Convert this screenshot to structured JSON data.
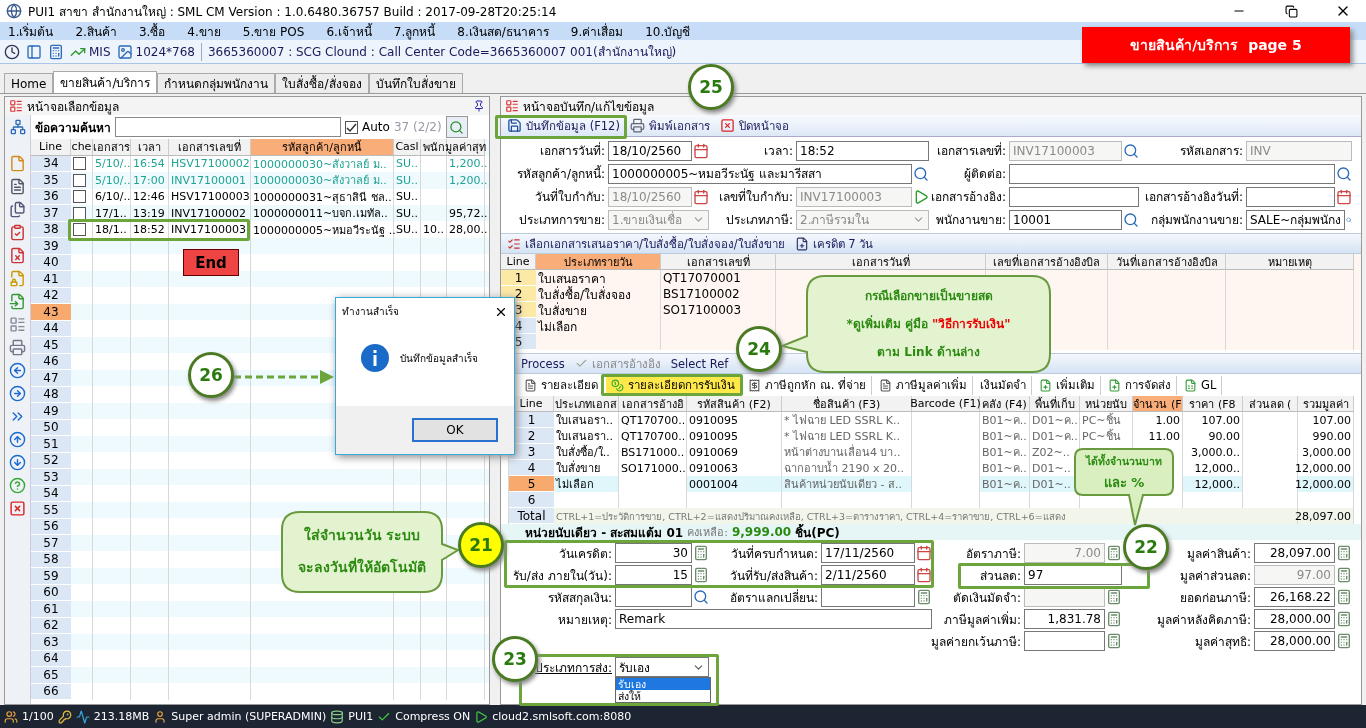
{
  "window": {
    "title": "PUI1 สาขา สำนักงานใหญ่ : SML CM Version : 1.0.6480.36757  Build : 2017-09-28T20:25:14"
  },
  "menu": [
    "1.เริ่มต้น",
    "2.สินค้า",
    "3.ซื้อ",
    "4.ขาย",
    "5.ขาย POS",
    "6.เจ้าหนี้",
    "7.ลูกหนี้",
    "8.เงินสด/ธนาคาร",
    "9.ค่าเสื่อม",
    "10.บัญชี"
  ],
  "toolbar": {
    "mis": "MIS",
    "resolution": "1024*768",
    "info": "3665360007 : SCG Clound : Call Center Code=3665360007 001(สำนักงานใหญ่)"
  },
  "banner": "ขายสินค้า/บริการ  page 5",
  "tabs": [
    {
      "label": "Home",
      "selected": false
    },
    {
      "label": "ขายสินค้า/บริการ",
      "selected": true
    },
    {
      "label": "กำหนดกลุ่มพนักงาน",
      "selected": false
    },
    {
      "label": "ใบสั่งซื้อ/สั่งจอง",
      "selected": false
    },
    {
      "label": "บันทึกใบสั่งขาย",
      "selected": false
    }
  ],
  "browser": {
    "title": "หน้าจอเลือกข้อมูล",
    "search_label": "ข้อความค้นหา",
    "auto": {
      "label": "Auto",
      "checked": true
    },
    "count": "37 (2/2)",
    "end_button": "End",
    "columns": [
      {
        "label": "Line",
        "sorted": false
      },
      {
        "label": "che",
        "sorted": false
      },
      {
        "label": "เอกสาร",
        "sorted": false
      },
      {
        "label": "เวลา",
        "sorted": false
      },
      {
        "label": "เอกสารเลขที่",
        "sorted": false
      },
      {
        "label": "รหัสลูกค้า/ลูกหนี้",
        "sorted": true
      },
      {
        "label": "Casl",
        "sorted": false
      },
      {
        "label": "พนัก",
        "sorted": false
      },
      {
        "label": "มูลค่าสุท",
        "sorted": false
      }
    ],
    "rows": [
      {
        "line": "34",
        "selected": false,
        "checked": false,
        "color": "#1fa393",
        "cells": [
          "5/10/..",
          "16:54",
          "HSV17100002",
          "1000000030~สังวาลย์ ม..",
          "SU..",
          null,
          "1,200.."
        ]
      },
      {
        "line": "35",
        "selected": false,
        "checked": false,
        "color": "#1fa393",
        "cells": [
          "5/10/..",
          "17:00",
          "INV17100001",
          "1000000030~สังวาลย์ ม..",
          "SU..",
          null,
          "1,200.."
        ]
      },
      {
        "line": "36",
        "selected": false,
        "checked": false,
        "color": "#000000",
        "cells": [
          "6/10/..",
          "12:46",
          "HSV17100003",
          "1000000031~สุธาสินี ชล..",
          "SU..",
          null,
          null
        ]
      },
      {
        "line": "37",
        "selected": false,
        "checked": false,
        "color": "#000000",
        "cells": [
          "17/1..",
          "13:19",
          "INV17100002",
          "1000000011~บจก.เมทัล..",
          "SU..",
          null,
          "95,72.."
        ]
      },
      {
        "line": "38",
        "selected": false,
        "checked": false,
        "color": "#000000",
        "cells": [
          "18/1..",
          "18:52",
          "INV17100003",
          "1000000005~หมอวีระนัฐ ..",
          "SU..",
          "10..",
          "28,00.."
        ]
      },
      {
        "line": "39",
        "selected": false
      },
      {
        "line": "40",
        "selected": false
      },
      {
        "line": "41",
        "selected": false
      },
      {
        "line": "42",
        "selected": false
      },
      {
        "line": "43",
        "selected": true
      },
      {
        "line": "44",
        "selected": false
      },
      {
        "line": "45",
        "selected": false
      },
      {
        "line": "46",
        "selected": false
      },
      {
        "line": "47",
        "selected": false
      },
      {
        "line": "48",
        "selected": false
      },
      {
        "line": "49",
        "selected": false
      },
      {
        "line": "50",
        "selected": false
      },
      {
        "line": "51",
        "selected": false
      },
      {
        "line": "52",
        "selected": false
      },
      {
        "line": "53",
        "selected": false
      },
      {
        "line": "54",
        "selected": false
      },
      {
        "line": "55",
        "selected": false
      },
      {
        "line": "56",
        "selected": false
      },
      {
        "line": "57",
        "selected": false
      },
      {
        "line": "58",
        "selected": false
      },
      {
        "line": "59",
        "selected": false
      },
      {
        "line": "60",
        "selected": false
      },
      {
        "line": "61",
        "selected": false
      },
      {
        "line": "62",
        "selected": false
      },
      {
        "line": "63",
        "selected": false
      },
      {
        "line": "64",
        "selected": false
      },
      {
        "line": "65",
        "selected": false
      },
      {
        "line": "66",
        "selected": false
      }
    ]
  },
  "dialog": {
    "title": "ทำงานสำเร็จ",
    "message": "บันทึกข้อมูลสำเร็จ",
    "ok": "OK"
  },
  "editor": {
    "title": "หน้าจอบันทึก/แก้ไขข้อมูล",
    "actions": [
      {
        "kind": "save",
        "label": "บันทึกข้อมูล (F12)"
      },
      {
        "kind": "print",
        "label": "พิมพ์เอกสาร"
      },
      {
        "kind": "close",
        "label": "ปิดหน้าจอ"
      }
    ],
    "header_rows": [
      [
        {
          "label": "เอกสารวันที่:",
          "value": "18/10/2560",
          "kind": "date",
          "disabled": false
        },
        {
          "label": "เวลา:",
          "value": "18:52",
          "kind": "text",
          "disabled": false
        },
        {
          "label": "เอกสารเลขที่:",
          "value": "INV17100003",
          "kind": "search",
          "disabled": true
        },
        {
          "label": "รหัสเอกสาร:",
          "value": "INV",
          "kind": "text",
          "disabled": true
        }
      ],
      [
        {
          "label": "รหัสลูกค้า/ลูกหนี้:",
          "value": "1000000005~หมอวีระนัฐ และมารีสสา",
          "kind": "search",
          "disabled": false,
          "wide": true
        },
        {
          "label": "ผู้ติดต่อ:",
          "kind": "search",
          "disabled": false,
          "wide": true
        }
      ],
      [
        {
          "label": "วันที่ใบกำกับ:",
          "value": "18/10/2560",
          "kind": "date",
          "disabled": true
        },
        {
          "label": "เลขที่ใบกำกับ:",
          "value": "INV17100003",
          "kind": "play",
          "disabled": true
        },
        {
          "label": "เอกสารอ้างอิง:",
          "kind": "text",
          "disabled": false
        },
        {
          "label": "เอกสารอ้างอิงวันที่:",
          "kind": "date",
          "disabled": false
        }
      ],
      [
        {
          "label": "ประเภทการขาย:",
          "value": "1.ขายเงินเชื่อ",
          "kind": "select",
          "disabled": true
        },
        {
          "label": "ประเภทภาษี:",
          "value": "2.ภาษีรวมใน",
          "kind": "select",
          "disabled": true
        },
        {
          "label": "พนักงานขาย:",
          "value": "10001",
          "kind": "search",
          "disabled": false
        },
        {
          "label": "กลุ่มพนักงานขาย:",
          "value": "SALE~กลุ่มพนักง",
          "kind": "search",
          "disabled": false
        }
      ]
    ],
    "ref_bar": {
      "select": "เลือกเอกสารเสนอราคา/ใบสั่งซื้อ/ใบสั่งจอง/ใบสั่งขาย",
      "credit": "เครดิต 7 วัน"
    },
    "ref_table": {
      "columns": [
        {
          "label": "Line",
          "sorted": false
        },
        {
          "label": "ประเภทรายวัน",
          "sorted": true
        },
        {
          "label": "เอกสารเลขที่",
          "sorted": false
        },
        {
          "label": "เอกสารวันที่",
          "sorted": false
        },
        {
          "label": "เลขที่เอกสารอ้างอิงบิล",
          "sorted": false
        },
        {
          "label": "วันที่เอกสารอ้างอิงบิล",
          "sorted": false
        },
        {
          "label": "หมายเหตุ",
          "sorted": false
        }
      ],
      "rows": [
        {
          "line": "1",
          "selected": true,
          "type": "ใบเสนอราคา",
          "doc": "QT17070001"
        },
        {
          "line": "2",
          "selected": true,
          "type": "ใบสั่งซื้อ/ใบสั่งจอง",
          "doc": "BS17100002"
        },
        {
          "line": "3",
          "selected": true,
          "type": "ใบสั่งขาย",
          "doc": "SO17100003"
        },
        {
          "line": "4",
          "selected": false,
          "type": "ไม่เลือก"
        },
        {
          "line": "5",
          "selected": false
        }
      ]
    },
    "process_bar": {
      "process": "Process",
      "reference": "เอกสารอ้างอิง",
      "select_ref": "Select Ref"
    },
    "detail_tabs": [
      {
        "label": "รายละเอียด",
        "selected": false
      },
      {
        "label": "รายละเอียดการรับเงิน",
        "selected": true
      },
      {
        "label": "ภาษีถูกหัก ณ. ที่จ่าย",
        "selected": false
      },
      {
        "label": "ภาษีมูลค่าเพิ่ม",
        "selected": false
      },
      {
        "label": "เงินมัดจำ",
        "selected": false
      },
      {
        "label": "เพิ่มเติม",
        "selected": false
      },
      {
        "label": "การจัดส่ง",
        "selected": false
      },
      {
        "label": "GL",
        "selected": false
      }
    ],
    "items": {
      "columns": [
        {
          "label": "Line",
          "sorted": false
        },
        {
          "label": "ประเภทเอกส",
          "sorted": false
        },
        {
          "label": "เอกสารอ้างอิ",
          "sorted": false
        },
        {
          "label": "รหัสสินค้า (F2)",
          "sorted": false
        },
        {
          "label": "ชื่อสินค้า (F3)",
          "sorted": false
        },
        {
          "label": "Barcode (F1)",
          "sorted": false
        },
        {
          "label": "คลัง (F4)",
          "sorted": false
        },
        {
          "label": "พื้นที่เก็บ",
          "sorted": false
        },
        {
          "label": "หน่วยนับ",
          "sorted": false
        },
        {
          "label": "จำนวน (F",
          "sorted": true
        },
        {
          "label": "ราคา (F8",
          "sorted": false
        },
        {
          "label": "ส่วนลด (",
          "sorted": false
        },
        {
          "label": "รวมมูลค่า",
          "sorted": false
        }
      ],
      "rows": [
        {
          "line": "1",
          "selected": false,
          "cells": [
            "ใบเสนอรา..",
            "QT170700..",
            "0910095",
            "* ไฟฉาย LED SSRL K..",
            null,
            "B01~ค..",
            "D01~ค..",
            "PC~ชิ้น",
            "1.00",
            "107.00",
            null,
            "107.00"
          ]
        },
        {
          "line": "2",
          "selected": false,
          "cells": [
            "ใบเสนอรา..",
            "QT170700..",
            "0910095",
            "* ไฟฉาย LED SSRL K..",
            null,
            "B01~ค..",
            "D01~ค..",
            "PC~ชิ้น",
            "11.00",
            "90.00",
            null,
            "990.00"
          ]
        },
        {
          "line": "3",
          "selected": false,
          "cells": [
            "ใบสั่งซื้อ/ใ..",
            "BS171000..",
            "0910069",
            "หน้าต่างบานเลื่อน4 บา..",
            null,
            "B01~ค..",
            "Z02~..",
            null,
            null,
            "3,000.0..",
            null,
            "3,000.00"
          ]
        },
        {
          "line": "4",
          "selected": false,
          "cells": [
            "ใบสั่งขาย",
            "SO171000..",
            "0910063",
            "ฉากอาบน้ำ 2190 x 20..",
            null,
            "B01~ค..",
            "D01~..",
            null,
            null,
            "12,000..",
            null,
            "12,000.00"
          ]
        },
        {
          "line": "5",
          "selected": true,
          "cells": [
            "ไม่เลือก",
            null,
            "0001004",
            "สินค้าหน่วยนับเดียว - ส..",
            null,
            "B01~ค..",
            "D01~..",
            null,
            null,
            "12,000..",
            null,
            "12,000.00"
          ]
        },
        {
          "line": "6",
          "selected": false
        }
      ],
      "total_label": "Total",
      "hint": "CTRL+1=ประวัติการขาย, CTRL+2=แสดงปริมาณคงเหลือ, CTRL+3=ตารางราคา, CTRL+4=ราคาขาย, CTRL+6=แสดง",
      "total": "28,097.00"
    },
    "stock_info": {
      "item": "หน่วยนับเดียว - สะสมแต้ม 01",
      "remain_label": "คงเหลือ:",
      "remain": "9,999.00",
      "unit": "ชิ้น(PC)"
    },
    "footer_rows": [
      [
        {
          "label": "วันเครดิต:",
          "value": "30",
          "kind": "calc",
          "disabled": false
        },
        {
          "label": "วันที่ครบกำหนด:",
          "value": "17/11/2560",
          "kind": "date",
          "disabled": false
        },
        {
          "label": "อัตราภาษี:",
          "value": "7.00",
          "kind": "calc",
          "disabled": true
        },
        {
          "label": "มูลค่าสินค้า:",
          "value": "28,097.00",
          "kind": "calc",
          "disabled": false
        }
      ],
      [
        {
          "label": "รับ/ส่ง ภายใน(วัน):",
          "value": "15",
          "kind": "calc",
          "disabled": false
        },
        {
          "label": "วันที่รับ/ส่งสินค้า:",
          "value": "2/11/2560",
          "kind": "date",
          "disabled": false
        },
        {
          "label": "ส่วนลด:",
          "value": "97",
          "kind": "text",
          "disabled": false
        },
        {
          "label": "มูลค่าส่วนลด:",
          "value": "97.00",
          "kind": "calc",
          "disabled": true
        }
      ],
      [
        {
          "label": "รหัสสกุลเงิน:",
          "kind": "search",
          "disabled": false
        },
        {
          "label": "อัตราแลกเปลี่ยน:",
          "kind": "calc",
          "disabled": false
        },
        {
          "label": "ตัดเงินมัดจำ:",
          "kind": "calc",
          "disabled": true
        },
        {
          "label": "ยอดก่อนภาษี:",
          "value": "26,168.22",
          "kind": "calc",
          "disabled": false
        }
      ],
      [
        {
          "label": "หมายเหตุ:",
          "value": "Remark",
          "kind": "text",
          "disabled": false,
          "wide": true
        },
        {
          "label": "ภาษีมูลค่าเพิ่ม:",
          "value": "1,831.78",
          "kind": "calc",
          "disabled": false
        },
        {
          "label": "มูลค่าหลังคิดภาษี:",
          "value": "28,000.00",
          "kind": "calc",
          "disabled": false
        }
      ],
      [
        null,
        null,
        {
          "label": "มูลค่ายกเว้นภาษี:",
          "kind": "calc",
          "disabled": false
        },
        {
          "label": "มูลค่าสุทธิ:",
          "value": "28,000.00",
          "kind": "calc",
          "disabled": false
        }
      ]
    ],
    "delivery": {
      "label": "ประเภทการส่ง:",
      "value": "รับเอง",
      "options": [
        {
          "label": "รับเอง",
          "selected": true
        },
        {
          "label": "ส่งให้",
          "selected": false
        }
      ]
    }
  },
  "status_bar": {
    "sessions": "1/100",
    "memory": "213.18MB",
    "user": "Super admin (SUPERADMIN)",
    "station": "PUI1",
    "compress": "Compress ON",
    "server": "cloud2.smlsoft.com:8080"
  },
  "annotations": {
    "markers": [
      {
        "number": "25",
        "color": "#ffffff"
      },
      {
        "number": "24",
        "color": "#ffffff"
      },
      {
        "number": "26",
        "color": "#ffffff"
      },
      {
        "number": "21",
        "color": "#ffff00"
      },
      {
        "number": "22",
        "color": "#ffffff"
      },
      {
        "number": "23",
        "color": "#ffffff"
      }
    ],
    "note_24": {
      "title": "กรณีเลือกขายเป็นขายสด",
      "guide": "*ดูเพิ่มเติม  คู่มือ",
      "guide_link": "\"วิธีการรับเงิน\"",
      "footer": "ตาม Link ด้านล่าง"
    },
    "note_21": [
      "ใส่จำนวนวัน ระบบ",
      "จะลงวันที่ให้อัตโนมัติ"
    ],
    "note_22": [
      "ได้ทั้งจำนวนบาท",
      "และ %"
    ]
  }
}
